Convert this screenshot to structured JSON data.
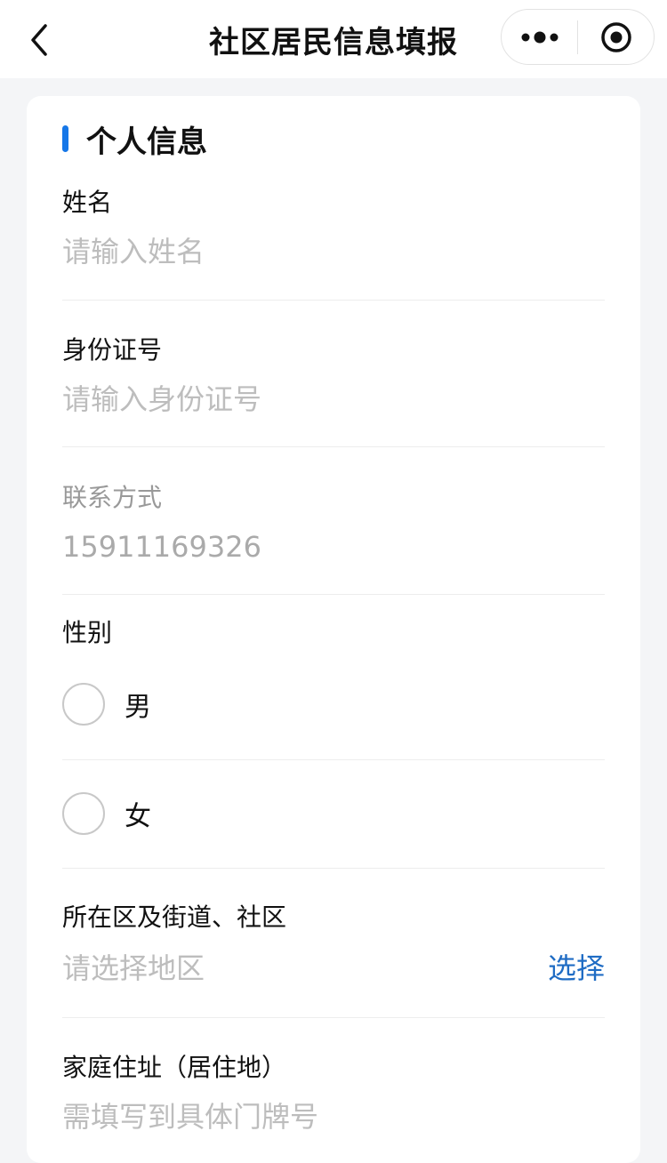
{
  "nav": {
    "title": "社区居民信息填报"
  },
  "section": {
    "title": "个人信息"
  },
  "fields": {
    "name": {
      "label": "姓名",
      "placeholder": "请输入姓名"
    },
    "id_number": {
      "label": "身份证号",
      "placeholder": "请输入身份证号"
    },
    "contact": {
      "label": "联系方式",
      "value": "15911169326"
    },
    "gender": {
      "label": "性别",
      "options": [
        "男",
        "女"
      ]
    },
    "district": {
      "label": "所在区及街道、社区",
      "placeholder": "请选择地区",
      "action": "选择"
    },
    "address": {
      "label": "家庭住址（居住地）",
      "placeholder": "需填写到具体门牌号"
    }
  },
  "colors": {
    "accent": "#1677e8",
    "link": "#1f6cc4",
    "placeholder": "#bdbdbd"
  },
  "icons": [
    "chevron-left-icon",
    "more-dots-icon",
    "close-target-icon"
  ]
}
